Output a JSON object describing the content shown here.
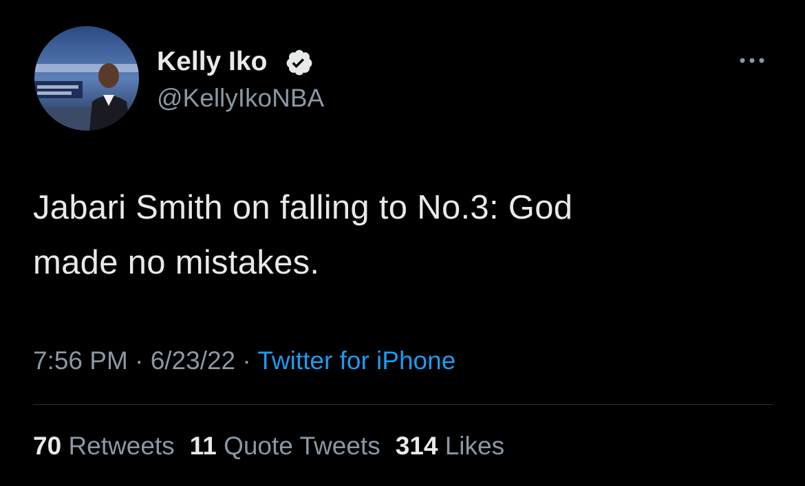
{
  "author": {
    "display_name": "Kelly Iko",
    "handle": "@KellyIkoNBA",
    "verified": true,
    "avatar_icon": "profile-photo"
  },
  "tweet": {
    "text_line1": "Jabari Smith on falling to No.3: God",
    "text_line2": "made no mistakes."
  },
  "meta": {
    "time": "7:56 PM",
    "separator": " · ",
    "date": "6/23/22",
    "source": "Twitter for iPhone"
  },
  "stats": {
    "retweets_count": "70",
    "retweets_label": "Retweets",
    "quotes_count": "11",
    "quotes_label": "Quote Tweets",
    "likes_count": "314",
    "likes_label": "Likes"
  },
  "colors": {
    "background": "#000000",
    "primary_text": "#e7e9ea",
    "secondary_text": "#8b98a5",
    "link": "#1d9bf0",
    "divider": "#2f3336"
  }
}
